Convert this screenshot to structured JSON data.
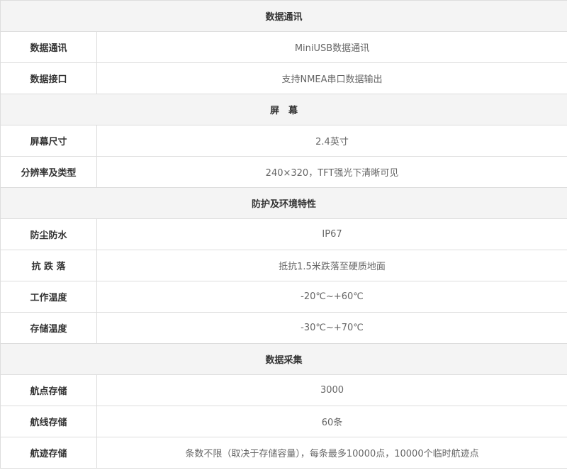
{
  "sections": [
    {
      "title": "数据通讯",
      "rows": [
        {
          "label": "数据通讯",
          "value": "MiniUSB数据通讯"
        },
        {
          "label": "数据接口",
          "value": "支持NMEA串口数据输出"
        }
      ]
    },
    {
      "title": "屏　幕",
      "rows": [
        {
          "label": "屏幕尺寸",
          "value": "2.4英寸"
        },
        {
          "label": "分辨率及类型",
          "value": "240×320，TFT强光下清晰可见"
        }
      ]
    },
    {
      "title": "防护及环境特性",
      "rows": [
        {
          "label": "防尘防水",
          "value": "IP67"
        },
        {
          "label": "抗 跌 落",
          "value": "抵抗1.5米跌落至硬质地面"
        },
        {
          "label": "工作温度",
          "value": "-20℃~+60℃"
        },
        {
          "label": "存储温度",
          "value": "-30℃~+70℃"
        }
      ]
    },
    {
      "title": "数据采集",
      "rows": [
        {
          "label": "航点存储",
          "value": "3000"
        },
        {
          "label": "航线存储",
          "value": "60条"
        },
        {
          "label": "航迹存储",
          "value": "条数不限（取决于存储容量），每条最多10000点，10000个临时航迹点"
        }
      ]
    }
  ]
}
